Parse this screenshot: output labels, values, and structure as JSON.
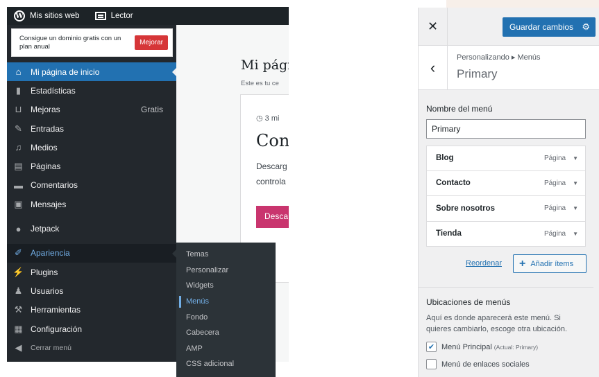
{
  "topbar": {
    "sites_label": "Mis sitios web",
    "reader_label": "Lector"
  },
  "promo": {
    "text": "Consigue un dominio gratis con un plan anual",
    "button": "Mejorar"
  },
  "menu": {
    "home": "Mi página de inicio",
    "stats": "Estadísticas",
    "upgrades": "Mejoras",
    "upgrades_badge": "Gratis",
    "posts": "Entradas",
    "media": "Medios",
    "pages": "Páginas",
    "comments": "Comentarios",
    "feedback": "Mensajes",
    "jetpack": "Jetpack",
    "appearance": "Apariencia",
    "plugins": "Plugins",
    "users": "Usuarios",
    "tools": "Herramientas",
    "settings": "Configuración",
    "collapse": "Cerrar menú"
  },
  "submenu": {
    "items": [
      "Temas",
      "Personalizar",
      "Widgets",
      "Menús",
      "Fondo",
      "Cabecera",
      "AMP",
      "CSS adicional"
    ]
  },
  "content": {
    "title": "Mi pági",
    "subtitle": "Este es tu ce",
    "time": "3 mi",
    "heading": "Con",
    "body_line1": "Descarg",
    "body_line2": "controla",
    "cta": "Desca"
  },
  "customizer": {
    "save_button": "Guardar cambios",
    "breadcrumb": "Personalizando ▸ Menús",
    "title": "Primary",
    "menu_name_label": "Nombre del menú",
    "menu_name_value": "Primary",
    "items": [
      {
        "label": "Blog",
        "type": "Página"
      },
      {
        "label": "Contacto",
        "type": "Página"
      },
      {
        "label": "Sobre nosotros",
        "type": "Página"
      },
      {
        "label": "Tienda",
        "type": "Página"
      }
    ],
    "reorder": "Reordenar",
    "add_items": "Añadir ítems",
    "locations_title": "Ubicaciones de menús",
    "locations_desc": "Aquí es donde aparecerá este menú. Si quieres cambiarlo, escoge otra ubicación.",
    "locations": [
      {
        "label": "Menú Principal",
        "note": "(Actual: Primary)",
        "checked": true
      },
      {
        "label": "Menú de enlaces sociales",
        "note": "",
        "checked": false
      }
    ]
  },
  "colors": {
    "admin_bg": "#23282d",
    "accent": "#2271b1",
    "upgrade": "#d63638",
    "cta": "#c9356e"
  }
}
